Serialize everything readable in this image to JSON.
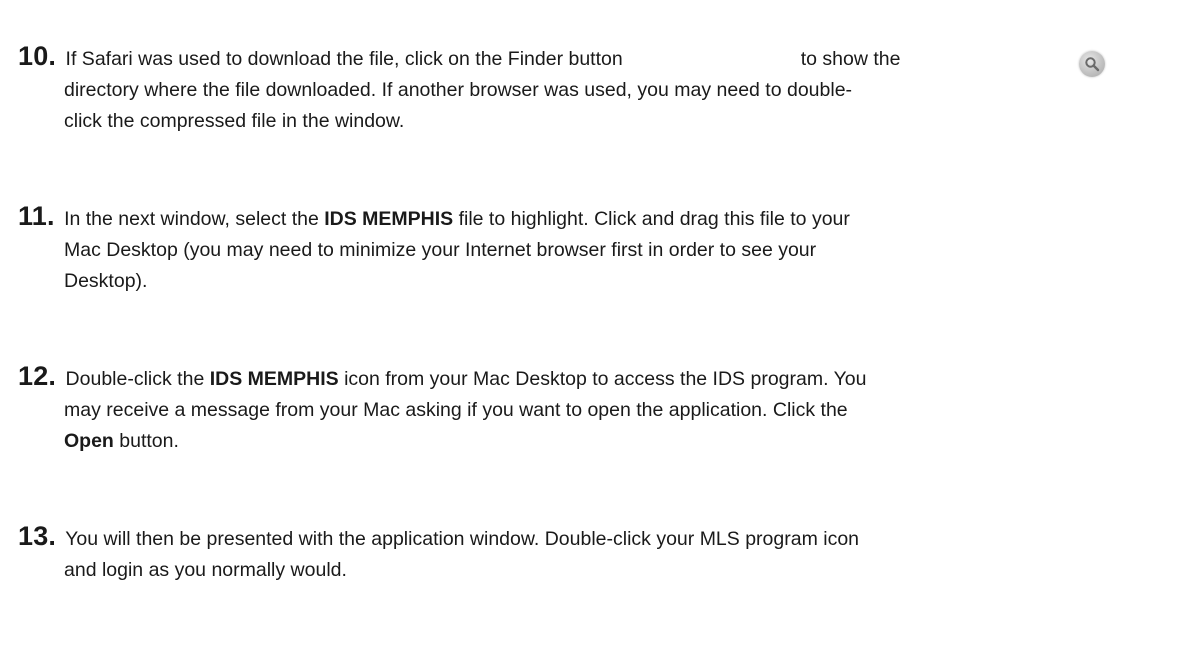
{
  "steps": [
    {
      "number": "10.",
      "line1_before_icon": " If Safari was used to download the file, click on the Finder button",
      "line1_after_icon": "to show the",
      "line2": "directory where the file downloaded.  If another browser was used, you may need to double-",
      "line3": "click the compressed file in the window.",
      "icon": "finder-magnifier-icon"
    },
    {
      "number": "11.",
      "line1_a": " In the next window, select the ",
      "line1_bold": "IDS MEMPHIS",
      "line1_b": " file to highlight. Click and drag this file to your",
      "line2": "Mac Desktop (you may need to minimize your Internet browser first in order to see your",
      "line3": "Desktop)."
    },
    {
      "number": "12.",
      "line1_a": " Double-click the ",
      "line1_bold": "IDS MEMPHIS",
      "line1_b": " icon from your Mac Desktop to access the IDS program. You",
      "line2": "may receive a message from your Mac asking if you want to open the application. Click the",
      "line3_bold": "Open",
      "line3_b": " button."
    },
    {
      "number": "13.",
      "line1": " You will then be presented with the application window. Double-click your MLS program icon",
      "line2": "and login as you normally would."
    }
  ]
}
